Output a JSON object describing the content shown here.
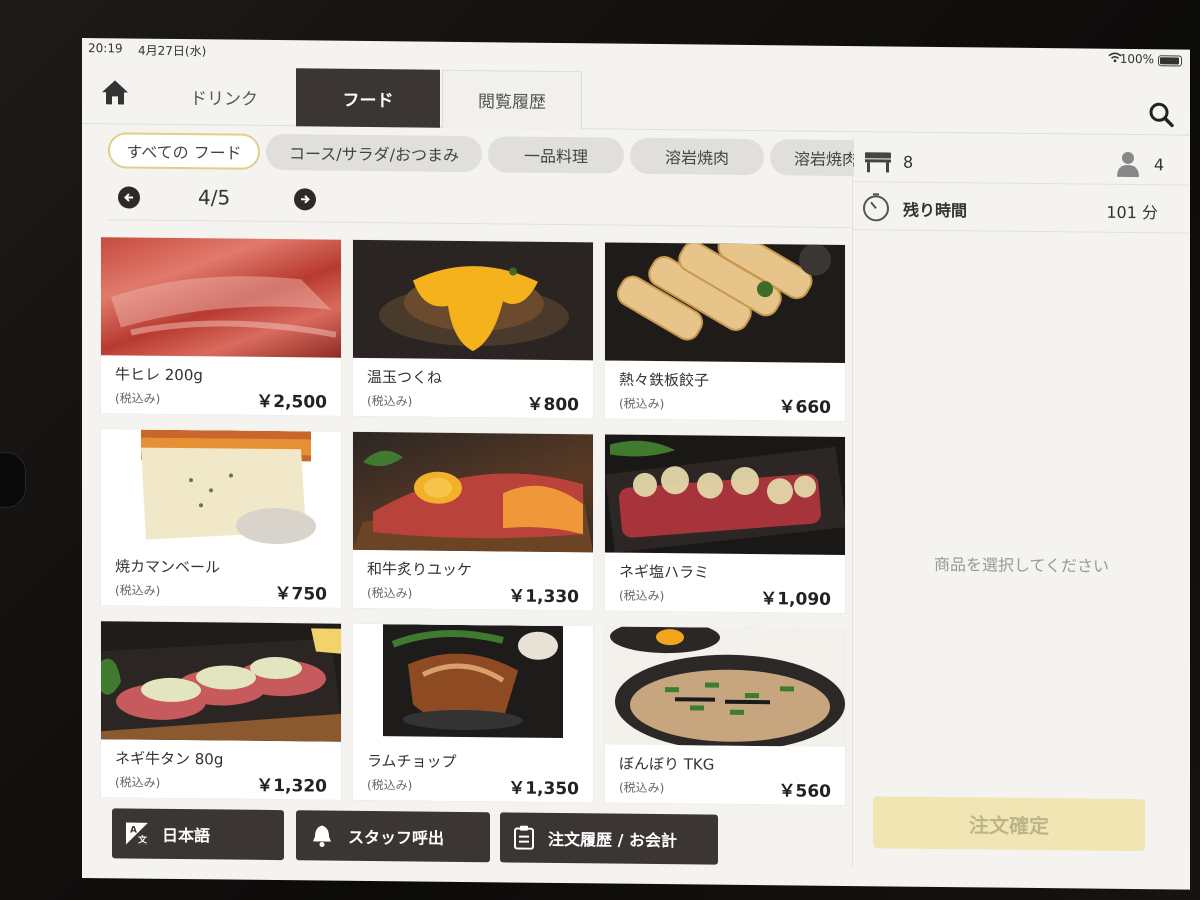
{
  "status_bar": {
    "time": "20:19",
    "date": "4月27日(水)",
    "battery": "100%"
  },
  "tabs": {
    "drink": "ドリンク",
    "food": "フード",
    "history": "閲覧履歴"
  },
  "categories": [
    "すべての フード",
    "コース/サラダ/おつまみ",
    "一品料理",
    "溶岩焼肉",
    "溶岩焼肉"
  ],
  "pager": {
    "text": "4/5"
  },
  "menu_items": [
    {
      "name": "牛ヒレ 200g",
      "tax": "(税込み)",
      "price": "￥2,500"
    },
    {
      "name": "温玉つくね",
      "tax": "(税込み)",
      "price": "￥800"
    },
    {
      "name": "熱々鉄板餃子",
      "tax": "(税込み)",
      "price": "￥660"
    },
    {
      "name": "焼カマンベール",
      "tax": "(税込み)",
      "price": "￥750"
    },
    {
      "name": "和牛炙りユッケ",
      "tax": "(税込み)",
      "price": "￥1,330"
    },
    {
      "name": "ネギ塩ハラミ",
      "tax": "(税込み)",
      "price": "￥1,090"
    },
    {
      "name": "ネギ牛タン 80g",
      "tax": "(税込み)",
      "price": "￥1,320"
    },
    {
      "name": "ラムチョップ",
      "tax": "(税込み)",
      "price": "￥1,350"
    },
    {
      "name": "ぼんぼり TKG",
      "tax": "(税込み)",
      "price": "￥560"
    }
  ],
  "side_panel": {
    "seat": "8",
    "people": "4",
    "remaining_label": "残り時間",
    "remaining_value": "101 分",
    "empty_message": "商品を選択してください",
    "confirm_button": "注文確定"
  },
  "bottom_buttons": {
    "language": "日本語",
    "staff_call": "スタッフ呼出",
    "order_history": "注文履歴 / お会計"
  },
  "colors": {
    "accent_dark": "#3b3534",
    "confirm_bg": "#efe6b4",
    "active_pill_border": "#e2cf87"
  }
}
